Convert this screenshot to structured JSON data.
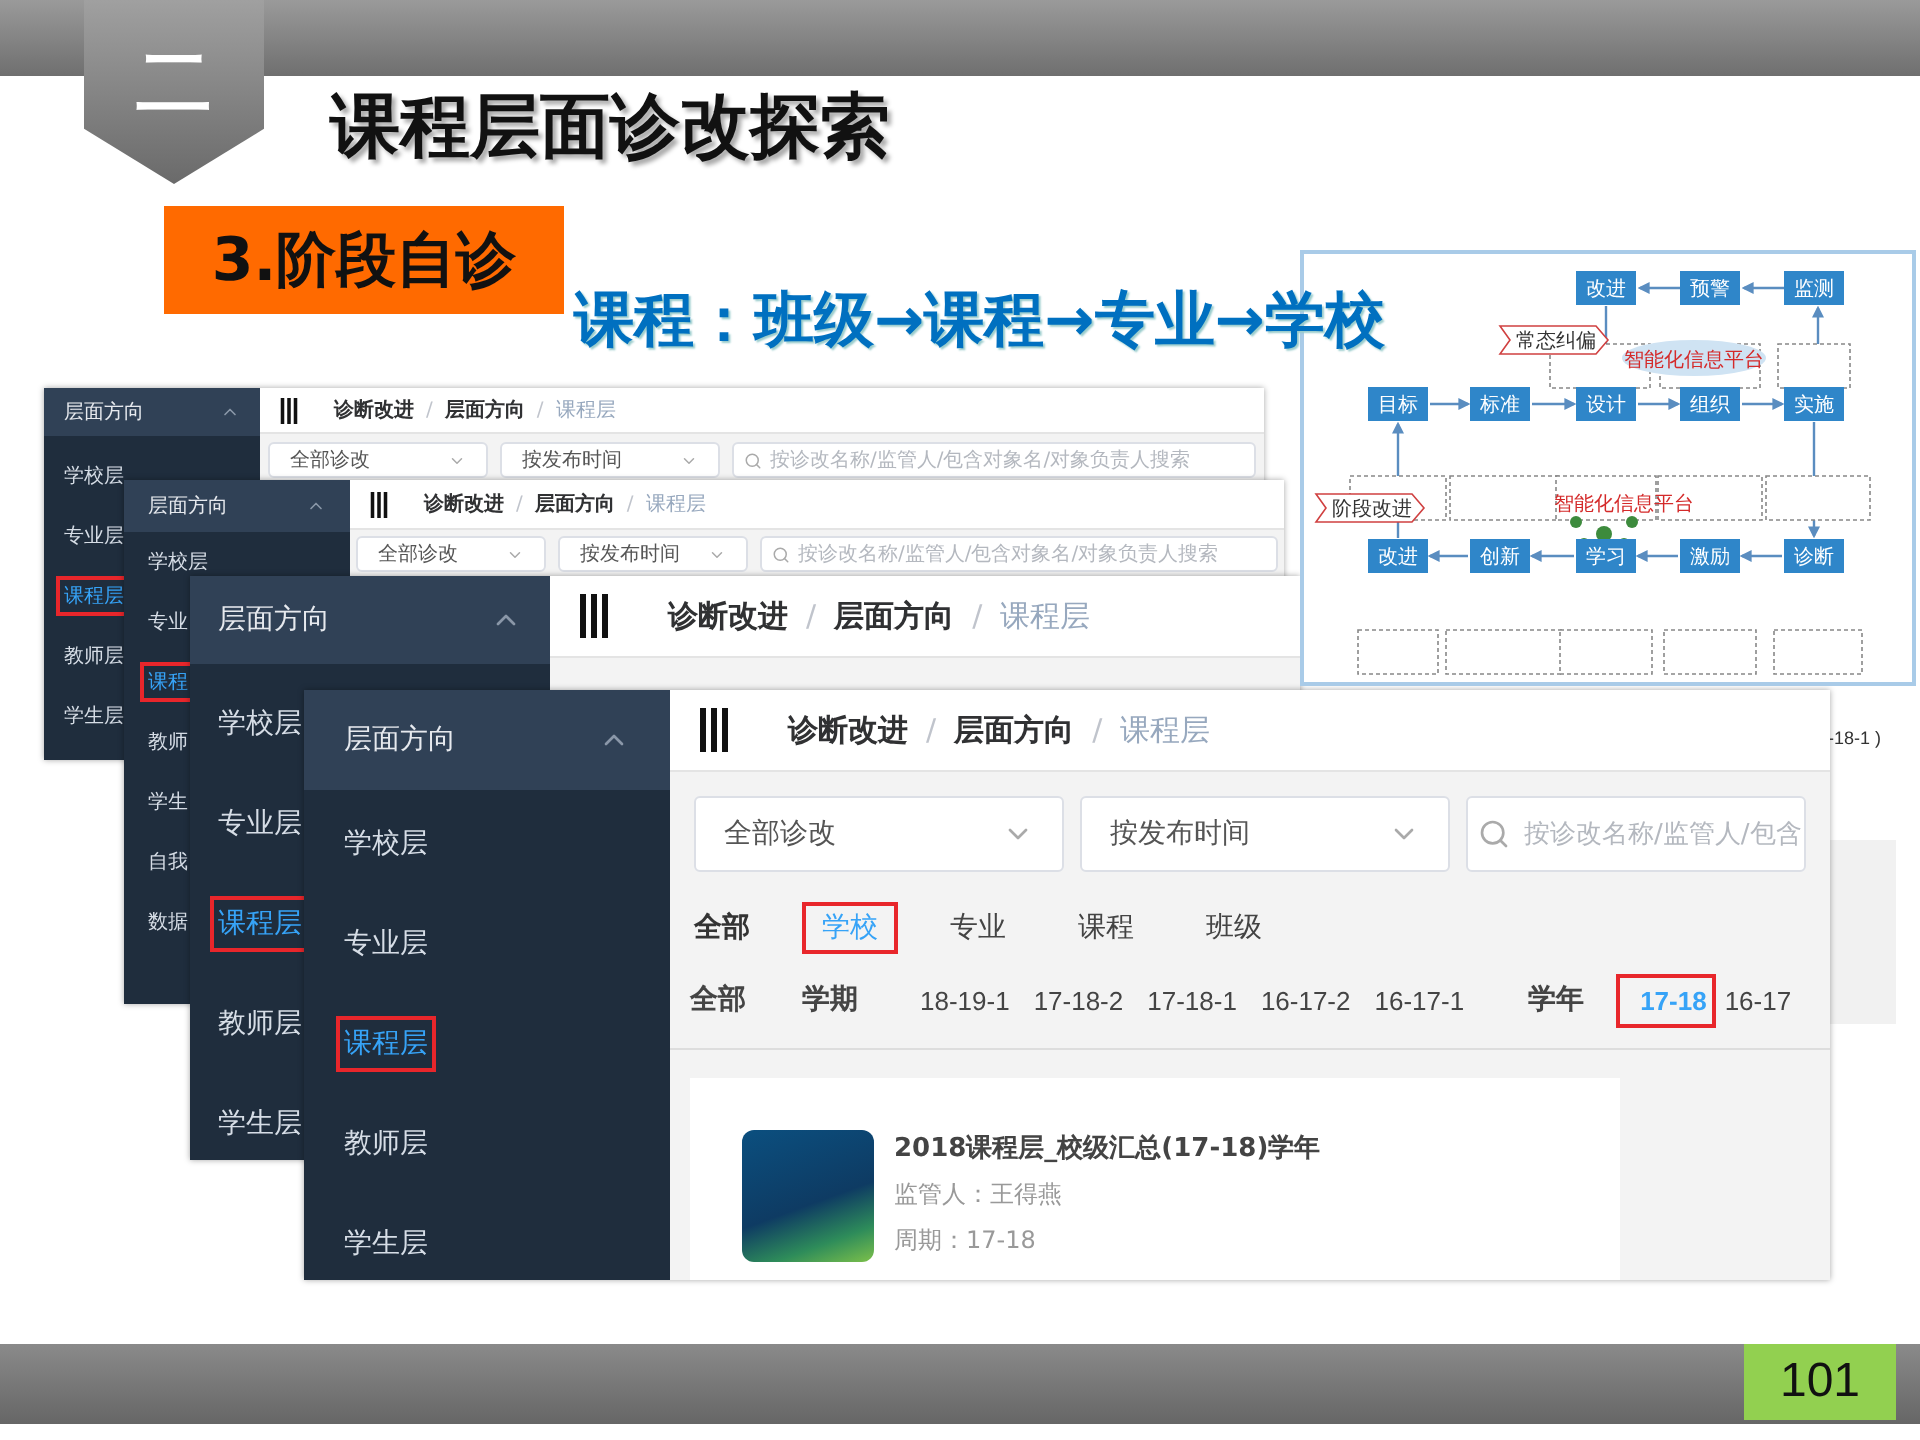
{
  "section_badge": "二",
  "title": "课程层面诊改探索",
  "step_label": "3.阶段自诊",
  "subtitle": "课程：班级→课程→专业→学校",
  "diagram": {
    "boxes": [
      {
        "label": "改进"
      },
      {
        "label": "预警"
      },
      {
        "label": "监测"
      },
      {
        "label": "目标"
      },
      {
        "label": "标准"
      },
      {
        "label": "设计"
      },
      {
        "label": "组织"
      },
      {
        "label": "实施"
      },
      {
        "label": "改进"
      },
      {
        "label": "创新"
      },
      {
        "label": "学习"
      },
      {
        "label": "激励"
      },
      {
        "label": "诊断"
      }
    ],
    "tags": [
      "常态纠偏",
      "阶段改进"
    ],
    "platform_labels": [
      "智能化信息平台",
      "智能化信息平台"
    ]
  },
  "screenshots": [
    {
      "sidebar": {
        "heading": "层面方向",
        "items": [
          {
            "label": "学校层",
            "selected": false
          },
          {
            "label": "专业层",
            "selected": false
          },
          {
            "label": "课程层",
            "selected": true
          },
          {
            "label": "教师层",
            "selected": false
          },
          {
            "label": "学生层",
            "selected": false
          }
        ]
      },
      "breadcrumb": [
        "诊断改进",
        "层面方向",
        "课程层"
      ],
      "separator": "/",
      "dropdowns": [
        "全部诊改",
        "按发布时间"
      ],
      "search": {
        "placeholder": "按诊改名称/监管人/包含对象名/对象负责人搜索"
      }
    },
    {
      "sidebar": {
        "heading": "层面方向",
        "items": [
          {
            "label": "学校层",
            "selected": false
          },
          {
            "label": "专业",
            "selected": false
          },
          {
            "label": "课程",
            "selected": true
          },
          {
            "label": "教师",
            "selected": false
          },
          {
            "label": "学生",
            "selected": false
          },
          {
            "label": "自我",
            "selected": false
          },
          {
            "label": "数据",
            "selected": false
          }
        ]
      },
      "breadcrumb": [
        "诊断改进",
        "层面方向",
        "课程层"
      ],
      "separator": "/",
      "dropdowns": [
        "全部诊改",
        "按发布时间"
      ],
      "search": {
        "placeholder": "按诊改名称/监管人/包含对象名/对象负责人搜索"
      }
    },
    {
      "sidebar": {
        "heading": "层面方向",
        "items": [
          {
            "label": "学校层",
            "selected": false
          },
          {
            "label": "专业层",
            "selected": false
          },
          {
            "label": "课程层",
            "selected": true
          },
          {
            "label": "教师层",
            "selected": false
          },
          {
            "label": "学生层",
            "selected": false
          }
        ]
      },
      "breadcrumb": [
        "诊断改进",
        "层面方向",
        "课程层"
      ],
      "separator": "/"
    },
    {
      "sidebar": {
        "heading": "层面方向",
        "items": [
          {
            "label": "学校层",
            "selected": false
          },
          {
            "label": "专业层",
            "selected": false
          },
          {
            "label": "课程层",
            "selected": true
          },
          {
            "label": "教师层",
            "selected": false
          },
          {
            "label": "学生层",
            "selected": false
          }
        ]
      },
      "breadcrumb": [
        "诊断改进",
        "层面方向",
        "课程层"
      ],
      "separator": "/",
      "dropdowns": [
        "全部诊改",
        "按发布时间"
      ],
      "search": {
        "placeholder": "按诊改名称/监管人/包含"
      },
      "scope_tabs": [
        {
          "label": "全部",
          "selected": false
        },
        {
          "label": "学校",
          "selected": true
        },
        {
          "label": "专业",
          "selected": false
        },
        {
          "label": "课程",
          "selected": false
        },
        {
          "label": "班级",
          "selected": false
        }
      ],
      "period_filter": {
        "all_label": "全部",
        "semester_label": "学期",
        "semesters": [
          {
            "label": "18-19-1",
            "selected": false
          },
          {
            "label": "17-18-2",
            "selected": false
          },
          {
            "label": "17-18-1",
            "selected": false
          },
          {
            "label": "16-17-2",
            "selected": false
          },
          {
            "label": "16-17-1",
            "selected": false
          }
        ],
        "year_label": "学年",
        "years": [
          {
            "label": "17-18",
            "selected": true
          },
          {
            "label": "16-17",
            "selected": false
          }
        ]
      },
      "card": {
        "title": "2018课程层_校级汇总(17-18)学年",
        "supervisor": "监管人：王得燕",
        "period": "周期：17-18"
      }
    }
  ],
  "background_fragment": "-18-1 )",
  "page_number": "101"
}
